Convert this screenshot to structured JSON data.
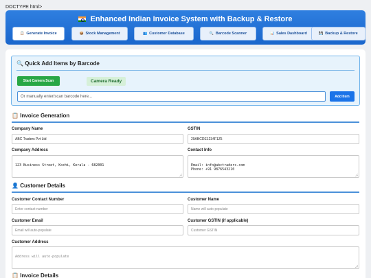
{
  "doctype_text": "DOCTYPE html>",
  "header": {
    "title": "Enhanced Indian Invoice System with Backup & Restore",
    "nav": [
      {
        "label": "Generate Invoice",
        "icon": "clipboard-icon",
        "active": true
      },
      {
        "label": "Stock Management",
        "icon": "box-icon",
        "active": false
      },
      {
        "label": "Customer Database",
        "icon": "users-icon",
        "active": false
      },
      {
        "label": "Barcode Scanner",
        "icon": "scanner-icon",
        "active": false
      },
      {
        "label": "Sales Dashboard",
        "icon": "chart-icon",
        "active": false
      },
      {
        "label": "Backup & Restore",
        "icon": "floppy-icon",
        "active": false
      }
    ]
  },
  "quick_add": {
    "title": "Quick Add Items by Barcode",
    "camera_button": "Start Camera Scan",
    "camera_status": "Camera Ready",
    "barcode_placeholder": "Or manually enter/scan barcode here...",
    "add_button": "Add Item"
  },
  "invoice_generation": {
    "title": "Invoice Generation",
    "company_name_label": "Company Name",
    "company_name_value": "ABC Traders Pvt Ltd",
    "gstin_label": "GSTIN",
    "gstin_value": "29ABCDE1234F1Z5",
    "company_address_label": "Company Address",
    "company_address_value": "123 Business Street, Kochi, Kerala - 682001",
    "contact_info_label": "Contact Info",
    "contact_info_value": "Email: info@abctraders.com\nPhone: +91 9876543210"
  },
  "customer_details": {
    "title": "Customer Details",
    "contact_number_label": "Customer Contact Number",
    "contact_number_placeholder": "Enter contact number",
    "name_label": "Customer Name",
    "name_placeholder": "Name will auto-populate",
    "email_label": "Customer Email",
    "email_placeholder": "Email will auto-populate",
    "gstin_label": "Customer GSTIN (if applicable)",
    "gstin_placeholder": "Customer GSTIN",
    "address_label": "Customer Address",
    "address_placeholder": "Address will auto-populate"
  },
  "invoice_details": {
    "title": "Invoice Details"
  },
  "colors": {
    "header_blue": "#1a66cc",
    "accent_green": "#28a745",
    "accent_blue": "#1a73e8",
    "section_line": "#4a90d9"
  }
}
